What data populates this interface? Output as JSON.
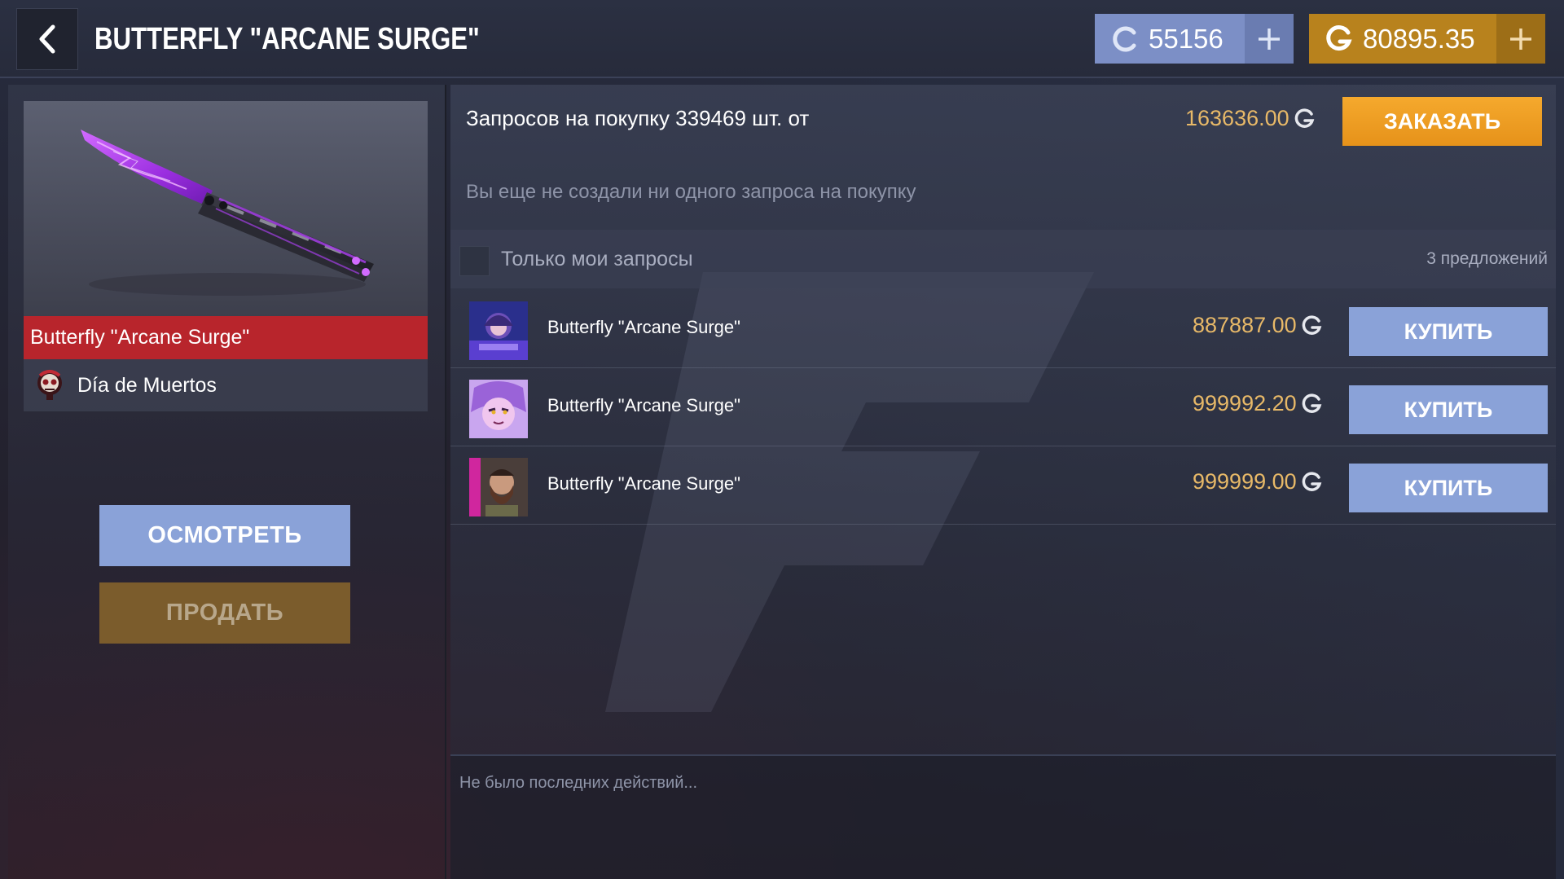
{
  "header": {
    "title": "BUTTERFLY \"ARCANE SURGE\"",
    "silver_balance": "55156",
    "gold_balance": "80895.35"
  },
  "item": {
    "name": "Butterfly \"Arcane Surge\"",
    "collection": "Día de Muertos",
    "inspect_label": "ОСМОТРЕТЬ",
    "sell_label": "ПРОДАТЬ"
  },
  "market": {
    "request_text": "Запросов на покупку 339469 шт. от",
    "request_price": "163636.00",
    "order_label": "ЗАКАЗАТЬ",
    "no_requests": "Вы еще не создали ни одного запроса на покупку",
    "filter_label": "Только мои запросы",
    "offers_count": "3 предложений",
    "offers": [
      {
        "name": "Butterfly \"Arcane Surge\"",
        "price": "887887.00",
        "buy_label": "КУПИТЬ"
      },
      {
        "name": "Butterfly \"Arcane Surge\"",
        "price": "999992.20",
        "buy_label": "КУПИТЬ"
      },
      {
        "name": "Butterfly \"Arcane Surge\"",
        "price": "999999.00",
        "buy_label": "КУПИТЬ"
      }
    ],
    "activity": "Не было последних действий..."
  },
  "colors": {
    "rarity_red": "#b8252c",
    "gold_accent": "#e8b968",
    "order_orange": "#f5a92d",
    "button_blue": "#8aa2d8"
  },
  "icons": {
    "back": "chevron-left-icon",
    "silver_currency": "silver-coin-icon",
    "gold_currency": "gold-coin-icon",
    "add": "plus-icon"
  }
}
